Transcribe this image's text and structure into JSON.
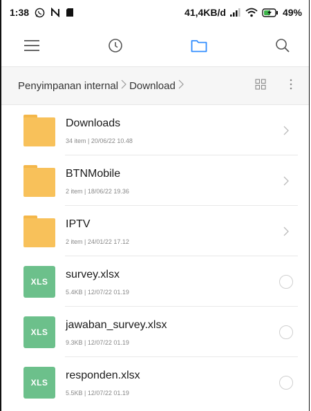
{
  "status_bar": {
    "time": "1:38",
    "net_speed": "41,4KB/d",
    "battery": "49%",
    "icons": [
      "whatsapp-icon",
      "n-notification-icon",
      "sd-card-icon",
      "signal-icon",
      "wifi-icon",
      "battery-charging-icon"
    ]
  },
  "toolbar": {
    "icons": [
      "menu-icon",
      "recent-clock-icon",
      "folder-icon",
      "search-icon"
    ],
    "active": "folder-icon",
    "accent": "#2f8cff"
  },
  "breadcrumb": {
    "items": [
      "Penyimpanan internal",
      "Download"
    ]
  },
  "files": [
    {
      "type": "folder",
      "name": "Downloads",
      "details": "34 item  |  20/06/22 10.48"
    },
    {
      "type": "folder",
      "name": "BTNMobile",
      "details": "2 item  |  18/06/22 19.36"
    },
    {
      "type": "folder",
      "name": "IPTV",
      "details": "2 item  |  24/01/22 17.12"
    },
    {
      "type": "xls",
      "badge": "XLS",
      "name": "survey.xlsx",
      "details": "5.4KB  |  12/07/22 01.19"
    },
    {
      "type": "xls",
      "badge": "XLS",
      "name": "jawaban_survey.xlsx",
      "details": "9.3KB  |  12/07/22 01.19"
    },
    {
      "type": "xls",
      "badge": "XLS",
      "name": "responden.xlsx",
      "details": "5.5KB  |  12/07/22 01.19"
    }
  ],
  "colors": {
    "folder": "#f8c15a",
    "xls": "#6cc08b",
    "breadcrumb_bg": "#f6f6f6"
  }
}
